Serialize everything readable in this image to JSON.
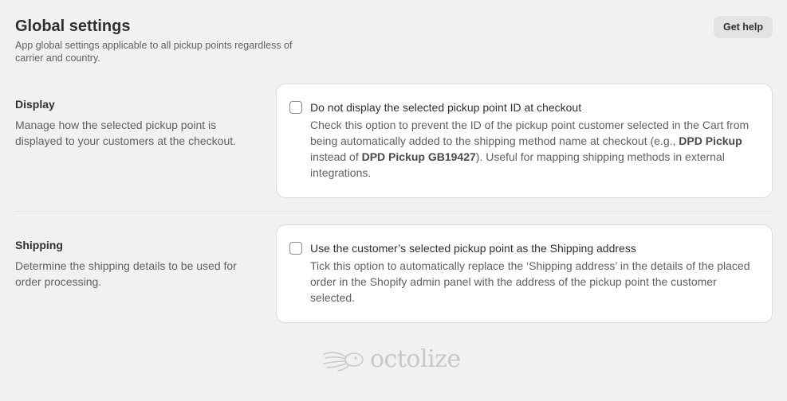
{
  "header": {
    "title": "Global settings",
    "subtitle": "App global settings applicable to all pickup points regardless of carrier and country.",
    "help_label": "Get help"
  },
  "display": {
    "title": "Display",
    "description": "Manage how the selected pickup point is displayed to your customers at the checkout.",
    "option": {
      "label": "Do not display the selected pickup point ID at checkout",
      "checked": false,
      "help_part1": "Check this option to prevent the ID of the pickup point customer selected in the Cart from being automatically added to the shipping method name at checkout (e.g., ",
      "help_bold1": "DPD Pickup",
      "help_part2": " instead of ",
      "help_bold2": "DPD Pickup GB19427",
      "help_part3": "). Useful for mapping shipping methods in external integrations."
    }
  },
  "shipping": {
    "title": "Shipping",
    "description": "Determine the shipping details to be used for order processing.",
    "option": {
      "label": "Use the customer’s selected pickup point as the Shipping address",
      "checked": false,
      "help": "Tick this option to automatically replace the ‘Shipping address’ in the details of the placed order in the Shopify admin panel with the address of the pickup point the customer selected."
    }
  },
  "footer": {
    "logo_text": "octolize",
    "logo_icon": "octopus-icon"
  }
}
